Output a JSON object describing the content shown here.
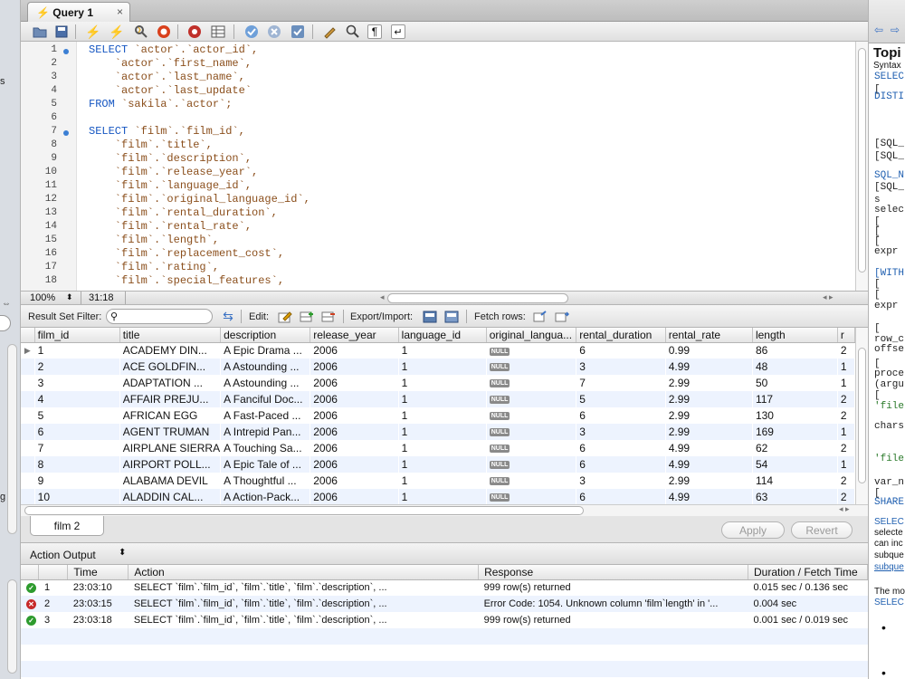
{
  "query_tab": {
    "label": "Query 1",
    "close": "×"
  },
  "toolbar": {
    "items": [
      {
        "name": "open-file-icon",
        "glyph": "📂"
      },
      {
        "name": "save-icon",
        "glyph": "💾"
      },
      {
        "name": "execute-icon",
        "glyph": "⚡"
      },
      {
        "name": "execute-current-icon",
        "glyph": "⚡"
      },
      {
        "name": "explain-icon",
        "glyph": "🔍"
      },
      {
        "name": "stop-icon",
        "glyph": "⛔"
      },
      {
        "name": "toggle-output-icon",
        "glyph": "⊘"
      },
      {
        "name": "results-grid-icon",
        "glyph": "▦"
      },
      {
        "name": "commit-icon",
        "glyph": "✔"
      },
      {
        "name": "rollback-icon",
        "glyph": "✖"
      },
      {
        "name": "autocommit-icon",
        "glyph": "⟳"
      },
      {
        "name": "beautify-icon",
        "glyph": "✎"
      },
      {
        "name": "find-icon",
        "glyph": "🔍"
      },
      {
        "name": "invisible-chars-icon",
        "glyph": "¶"
      },
      {
        "name": "wrap-icon",
        "glyph": "↵"
      }
    ]
  },
  "editor": {
    "lines": [
      {
        "n": "1",
        "dot": true,
        "kw": "SELECT",
        "text": " `actor`.`actor_id`,"
      },
      {
        "n": "2",
        "dot": false,
        "kw": "",
        "text": "    `actor`.`first_name`,"
      },
      {
        "n": "3",
        "dot": false,
        "kw": "",
        "text": "    `actor`.`last_name`,"
      },
      {
        "n": "4",
        "dot": false,
        "kw": "",
        "text": "    `actor`.`last_update`"
      },
      {
        "n": "5",
        "dot": false,
        "kw": "FROM",
        "text": " `sakila`.`actor`;"
      },
      {
        "n": "6",
        "dot": false,
        "kw": "",
        "text": ""
      },
      {
        "n": "7",
        "dot": true,
        "kw": "SELECT",
        "text": " `film`.`film_id`,"
      },
      {
        "n": "8",
        "dot": false,
        "kw": "",
        "text": "    `film`.`title`,"
      },
      {
        "n": "9",
        "dot": false,
        "kw": "",
        "text": "    `film`.`description`,"
      },
      {
        "n": "10",
        "dot": false,
        "kw": "",
        "text": "    `film`.`release_year`,"
      },
      {
        "n": "11",
        "dot": false,
        "kw": "",
        "text": "    `film`.`language_id`,"
      },
      {
        "n": "12",
        "dot": false,
        "kw": "",
        "text": "    `film`.`original_language_id`,"
      },
      {
        "n": "13",
        "dot": false,
        "kw": "",
        "text": "    `film`.`rental_duration`,"
      },
      {
        "n": "14",
        "dot": false,
        "kw": "",
        "text": "    `film`.`rental_rate`,"
      },
      {
        "n": "15",
        "dot": false,
        "kw": "",
        "text": "    `film`.`length`,"
      },
      {
        "n": "16",
        "dot": false,
        "kw": "",
        "text": "    `film`.`replacement_cost`,"
      },
      {
        "n": "17",
        "dot": false,
        "kw": "",
        "text": "    `film`.`rating`,"
      },
      {
        "n": "18",
        "dot": false,
        "kw": "",
        "text": "    `film`.`special_features`,"
      }
    ],
    "zoom": "100%",
    "cursor_position": "31:18"
  },
  "filter_bar": {
    "filter_label": "Result Set Filter:",
    "search_placeholder": "",
    "edit_label": "Edit:",
    "export_label": "Export/Import:",
    "fetch_label": "Fetch rows:"
  },
  "grid": {
    "columns": [
      "film_id",
      "title",
      "description",
      "release_year",
      "language_id",
      "original_langua...",
      "rental_duration",
      "rental_rate",
      "length",
      "r"
    ],
    "rows": [
      [
        "1",
        "ACADEMY DIN...",
        "A Epic Drama ...",
        "2006",
        "1",
        "NULL",
        "6",
        "0.99",
        "86",
        "2"
      ],
      [
        "2",
        "ACE GOLDFIN...",
        "A Astounding ...",
        "2006",
        "1",
        "NULL",
        "3",
        "4.99",
        "48",
        "1"
      ],
      [
        "3",
        "ADAPTATION ...",
        "A Astounding ...",
        "2006",
        "1",
        "NULL",
        "7",
        "2.99",
        "50",
        "1"
      ],
      [
        "4",
        "AFFAIR PREJU...",
        "A Fanciful Doc...",
        "2006",
        "1",
        "NULL",
        "5",
        "2.99",
        "117",
        "2"
      ],
      [
        "5",
        "AFRICAN EGG",
        "A Fast-Paced ...",
        "2006",
        "1",
        "NULL",
        "6",
        "2.99",
        "130",
        "2"
      ],
      [
        "6",
        "AGENT TRUMAN",
        "A Intrepid Pan...",
        "2006",
        "1",
        "NULL",
        "3",
        "2.99",
        "169",
        "1"
      ],
      [
        "7",
        "AIRPLANE SIERRA",
        "A Touching Sa...",
        "2006",
        "1",
        "NULL",
        "6",
        "4.99",
        "62",
        "2"
      ],
      [
        "8",
        "AIRPORT POLL...",
        "A Epic Tale of ...",
        "2006",
        "1",
        "NULL",
        "6",
        "4.99",
        "54",
        "1"
      ],
      [
        "9",
        "ALABAMA DEVIL",
        "A Thoughtful ...",
        "2006",
        "1",
        "NULL",
        "3",
        "2.99",
        "114",
        "2"
      ],
      [
        "10",
        "ALADDIN CAL...",
        "A Action-Pack...",
        "2006",
        "1",
        "NULL",
        "6",
        "4.99",
        "63",
        "2"
      ]
    ]
  },
  "result_tabs": {
    "active": "film 2",
    "apply_label": "Apply",
    "revert_label": "Revert"
  },
  "action_output": {
    "title": "Action Output",
    "columns": [
      "",
      "",
      "Time",
      "Action",
      "Response",
      "Duration / Fetch Time"
    ],
    "rows": [
      {
        "status": "ok",
        "n": "1",
        "time": "23:03:10",
        "action": "SELECT `film`.`film_id`,     `film`.`title`,     `film`.`description`,   ...",
        "response": "999 row(s) returned",
        "duration": "0.015 sec / 0.136 sec"
      },
      {
        "status": "error",
        "n": "2",
        "time": "23:03:15",
        "action": "SELECT `film`.`film_id`,     `film`.`title`,     `film`.`description`,   ...",
        "response": "Error Code: 1054. Unknown column 'film`length' in '...",
        "duration": "0.004 sec"
      },
      {
        "status": "ok",
        "n": "3",
        "time": "23:03:18",
        "action": "SELECT `film`.`film_id`,     `film`.`title`,     `film`.`description`,   ...",
        "response": "999 row(s) returned",
        "duration": "0.001 sec / 0.019 sec"
      }
    ]
  },
  "right_panel": {
    "title": "Topi",
    "subtitle": "Syntax",
    "code_lines": [
      {
        "cls": "blue",
        "text": "SELEC"
      },
      {
        "cls": "",
        "text": "   ["
      },
      {
        "cls": "blue",
        "text": "DISTI"
      },
      {
        "cls": "",
        "text": "[SQL_"
      },
      {
        "cls": "",
        "text": "[SQL_"
      },
      {
        "cls": "blue",
        "text": "SQL_N"
      },
      {
        "cls": "",
        "text": "[SQL_"
      },
      {
        "cls": "",
        "text": "   s"
      },
      {
        "cls": "",
        "text": "selec"
      },
      {
        "cls": "",
        "text": "   ["
      },
      {
        "cls": "",
        "text": "   ["
      },
      {
        "cls": "",
        "text": "   ["
      },
      {
        "cls": "",
        "text": "expr"
      },
      {
        "cls": "blue",
        "text": "[WITH"
      },
      {
        "cls": "",
        "text": "   ["
      },
      {
        "cls": "",
        "text": "   ["
      },
      {
        "cls": "",
        "text": "expr"
      },
      {
        "cls": "",
        "text": "   ["
      },
      {
        "cls": "",
        "text": "row_c"
      },
      {
        "cls": "",
        "text": "offse"
      },
      {
        "cls": "",
        "text": "   ["
      },
      {
        "cls": "",
        "text": "proce"
      },
      {
        "cls": "",
        "text": "(argu"
      },
      {
        "cls": "",
        "text": "   ["
      },
      {
        "cls": "grn",
        "text": "'file"
      },
      {
        "cls": "",
        "text": "chars"
      },
      {
        "cls": "grn",
        "text": "'file"
      },
      {
        "cls": "",
        "text": "var_n"
      },
      {
        "cls": "",
        "text": "   ["
      },
      {
        "cls": "blue",
        "text": "SHARE"
      }
    ],
    "text_lines": [
      {
        "cls": "blue",
        "text": "SELEC"
      },
      {
        "cls": "",
        "text": "selecte"
      },
      {
        "cls": "",
        "text": "can inc"
      },
      {
        "cls": "",
        "text": "subque"
      },
      {
        "cls": "blue",
        "text": "subque"
      },
      {
        "cls": "",
        "text": "The mo"
      },
      {
        "cls": "blue",
        "text": "SELEC"
      }
    ]
  },
  "left_strip": {
    "frag_1": "s",
    "frag_2": "g"
  }
}
